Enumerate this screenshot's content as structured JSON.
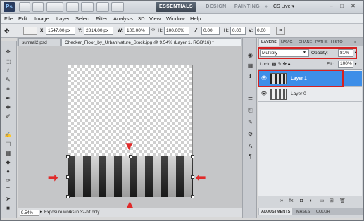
{
  "app": {
    "logo": "Ps",
    "cs_live": "CS Live ▾"
  },
  "workspaces": [
    "ESSENTIALS",
    "DESIGN",
    "PAINTING"
  ],
  "window_controls": [
    "–",
    "□",
    "✕"
  ],
  "menu": [
    "File",
    "Edit",
    "Image",
    "Layer",
    "Select",
    "Filter",
    "Analysis",
    "3D",
    "View",
    "Window",
    "Help"
  ],
  "options": {
    "x_label": "X:",
    "x_value": "1547.00 px",
    "y_label": "Y:",
    "y_value": "2814.00 px",
    "w_label": "W:",
    "w_value": "100.00%",
    "h_label": "H:",
    "h_value": "100.00%",
    "angle_value": "0.00",
    "hskew_label": "H:",
    "hskew_value": "0.00",
    "vskew_label": "V:",
    "vskew_value": "0.00"
  },
  "tabs": {
    "tab1": "surreal2.psd",
    "tab2": "Checker_Floor_by_UrbanNature_Stock.jpg @ 9.54% (Layer 1, RGB/16) *"
  },
  "status": {
    "zoom": "9.54%",
    "message": "Exposure works in 32-bit only"
  },
  "panel": {
    "tabs": [
      "LAYERS",
      "NAVIG",
      "CHANE",
      "PATHS",
      "HISTO"
    ],
    "blend_mode": "Multiply",
    "opacity_label": "Opacity:",
    "opacity_value": "81%",
    "lock_label": "Lock:",
    "fill_label": "Fill:",
    "fill_value": "100%",
    "layers": [
      {
        "name": "Layer 1",
        "selected": true
      },
      {
        "name": "Layer 0",
        "selected": false
      }
    ],
    "bottom_tabs": [
      "ADJUSTMENTS",
      "MASKS",
      "COLOR"
    ]
  },
  "colors": {
    "accent": "#3d8ee8",
    "highlight": "#d62020",
    "arrow": "#e02a2a"
  }
}
